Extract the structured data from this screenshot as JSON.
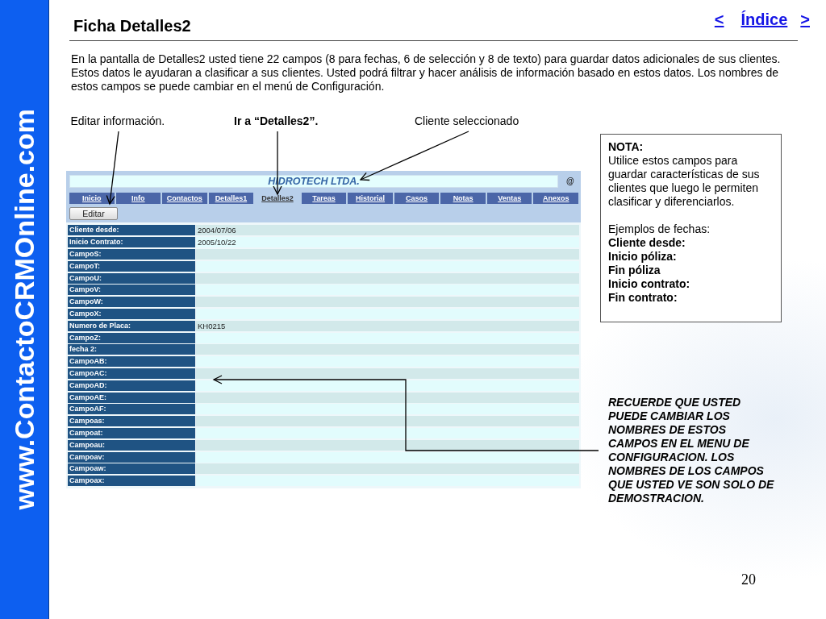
{
  "sidebar": {
    "brand": "www.ContactoCRMOnline.com"
  },
  "header": {
    "title": "Ficha Detalles2",
    "nav": [
      {
        "label": "<"
      },
      {
        "label": "Índice"
      },
      {
        "label": ">"
      }
    ]
  },
  "intro": "En la pantalla de Detalles2 usted tiene 22 campos (8 para fechas, 6 de selección y 8 de texto) para guardar datos adicionales de sus clientes. Estos datos le ayudaran a clasificar a sus clientes. Usted podrá filtrar y hacer análisis de información basado en estos datos. Los nombres de estos campos se puede cambiar en el menú de Configuración.",
  "callouts": [
    {
      "text": "Editar información.",
      "bold": false
    },
    {
      "text": "Ir a “Detalles2”.",
      "bold": true
    },
    {
      "text": "Cliente seleccionado",
      "bold": false
    }
  ],
  "app_screenshot": {
    "client_name": "HIDROTECH LTDA.",
    "at_sign": "@",
    "tabs": [
      {
        "label": "Inicio",
        "selected": false
      },
      {
        "label": "Info",
        "selected": false
      },
      {
        "label": "Contactos",
        "selected": false
      },
      {
        "label": "Detalles1",
        "selected": false
      },
      {
        "label": "Detalles2",
        "selected": true
      },
      {
        "label": "Tareas",
        "selected": false
      },
      {
        "label": "Historial",
        "selected": false
      },
      {
        "label": "Casos",
        "selected": false
      },
      {
        "label": "Notas",
        "selected": false
      },
      {
        "label": "Ventas",
        "selected": false
      },
      {
        "label": "Anexos",
        "selected": false
      }
    ],
    "edit_button": "Editar",
    "fields": [
      {
        "label": "Cliente desde:",
        "value": "2004/07/06"
      },
      {
        "label": "Inicio Contrato:",
        "value": "2005/10/22"
      },
      {
        "label": "CampoS:"
      },
      {
        "label": "CampoT:"
      },
      {
        "label": "CampoU:"
      },
      {
        "label": "CampoV:"
      },
      {
        "label": "CampoW:"
      },
      {
        "label": "CampoX:"
      },
      {
        "label": "Numero de Placa:",
        "value": "KH0215"
      },
      {
        "label": "CampoZ:"
      },
      {
        "label": "fecha 2:"
      },
      {
        "label": "CampoAB:"
      },
      {
        "label": "CampoAC:"
      },
      {
        "label": "CampoAD:"
      },
      {
        "label": "CampoAE:"
      },
      {
        "label": "CampoAF:"
      },
      {
        "label": "Campoas:"
      },
      {
        "label": "Campoat:"
      },
      {
        "label": "Campoau:"
      },
      {
        "label": "Campoav:"
      },
      {
        "label": "Campoaw:"
      },
      {
        "label": "Campoax:"
      }
    ]
  },
  "note": {
    "heading": "NOTA:",
    "text": "Utilice estos campos para guardar características de sus clientes que luego le permiten clasificar y diferenciarlos.",
    "examples_heading": "Ejemplos de fechas:",
    "examples": [
      "Cliente desde:",
      "Inicio póliza:",
      "Fin póliza",
      "Inicio contrato:",
      "Fin contrato:"
    ]
  },
  "reminder": "RECUERDE QUE USTED PUEDE CAMBIAR LOS NOMBRES DE ESTOS CAMPOS EN EL MENU DE CONFIGURACION. LOS NOMBRES DE LOS CAMPOS QUE USTED VE SON SOLO DE DEMOSTRACION.",
  "page_number": "20"
}
